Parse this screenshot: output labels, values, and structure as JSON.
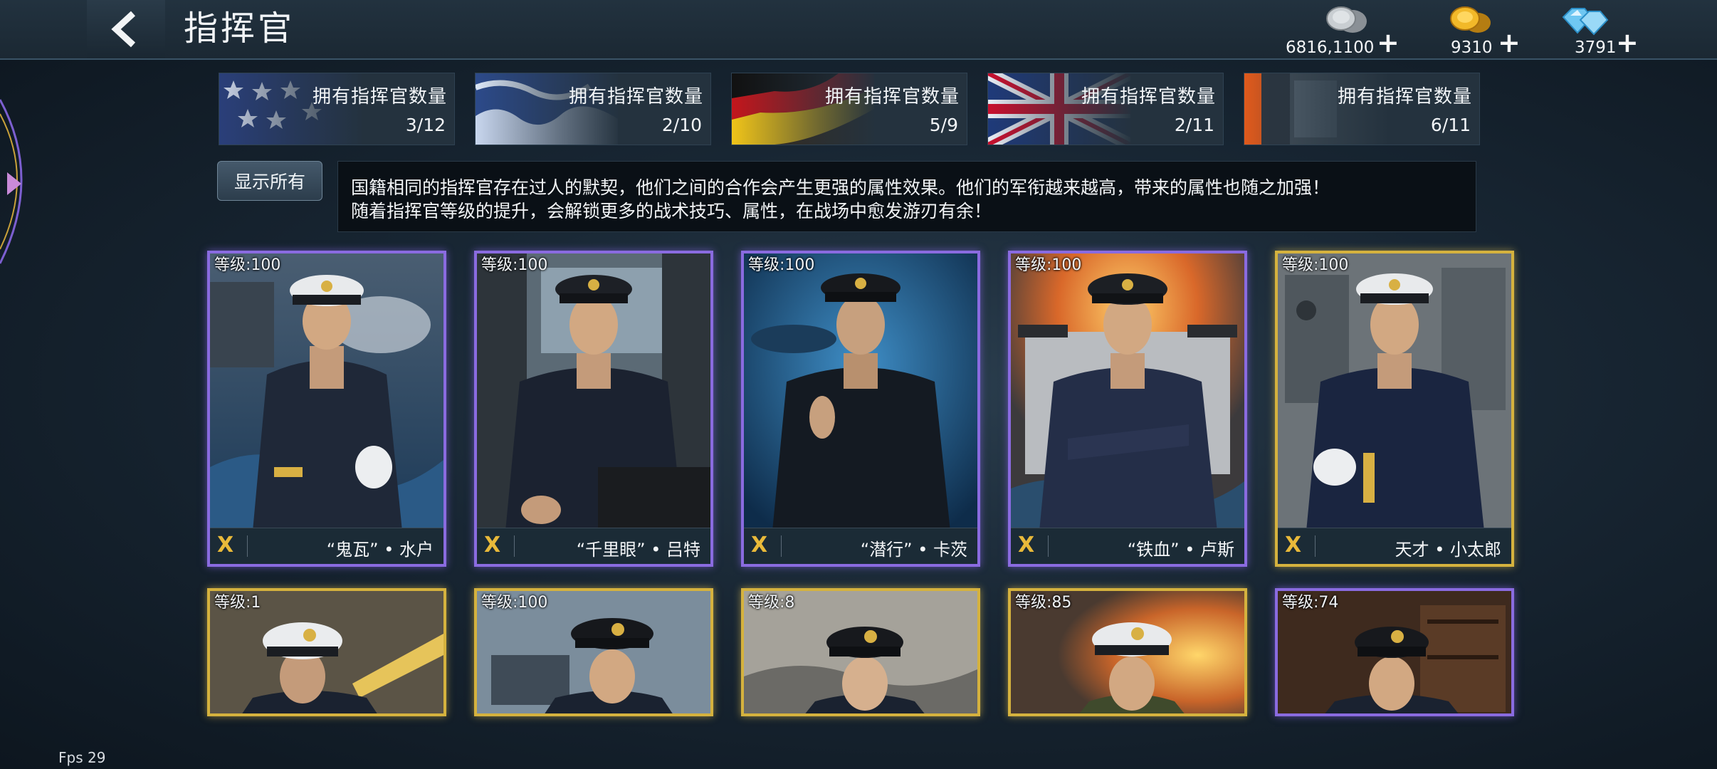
{
  "header": {
    "title": "指挥官"
  },
  "currencies": [
    {
      "icon": "silver-coin-icon",
      "amount": "6816,1100",
      "plus": "+"
    },
    {
      "icon": "gold-coin-icon",
      "amount": "9310",
      "plus": "+"
    },
    {
      "icon": "diamond-icon",
      "amount": "3791",
      "plus": "+"
    }
  ],
  "nations": [
    {
      "flag": "usa-flag",
      "label": "拥有指挥官数量",
      "count": "3/12"
    },
    {
      "flag": "japan-flag",
      "label": "拥有指挥官数量",
      "count": "2/10"
    },
    {
      "flag": "germany-flag",
      "label": "拥有指挥官数量",
      "count": "5/9"
    },
    {
      "flag": "uk-flag",
      "label": "拥有指挥官数量",
      "count": "2/11"
    },
    {
      "flag": "other-flag",
      "label": "拥有指挥官数量",
      "count": "6/11"
    }
  ],
  "filter": {
    "show_all": "显示所有"
  },
  "description": {
    "line1": "国籍相同的指挥官存在过人的默契，他们之间的合作会产生更强的属性效果。他们的军衔越来越高，带来的属性也随之加强！",
    "line2": "随着指挥官等级的提升，会解锁更多的战术技巧、属性，在战场中愈发游刃有余！"
  },
  "commanders": [
    {
      "level": "等级:100",
      "name": "“鬼瓦” • 水户",
      "rank_icon": "X",
      "frame": "purple"
    },
    {
      "level": "等级:100",
      "name": "“千里眼” • 吕特",
      "rank_icon": "X",
      "frame": "purple"
    },
    {
      "level": "等级:100",
      "name": "“潜行” • 卡茨",
      "rank_icon": "X",
      "frame": "purple"
    },
    {
      "level": "等级:100",
      "name": "“铁血” • 卢斯",
      "rank_icon": "X",
      "frame": "purple"
    },
    {
      "level": "等级:100",
      "name": "天才 • 小太郎",
      "rank_icon": "X",
      "frame": "gold"
    },
    {
      "level": "等级:1",
      "frame": "gold"
    },
    {
      "level": "等级:100",
      "frame": "gold"
    },
    {
      "level": "等级:8",
      "frame": "gold"
    },
    {
      "level": "等级:85",
      "frame": "gold"
    },
    {
      "level": "等级:74",
      "frame": "purple"
    }
  ],
  "debug": {
    "fps": "Fps 29"
  }
}
